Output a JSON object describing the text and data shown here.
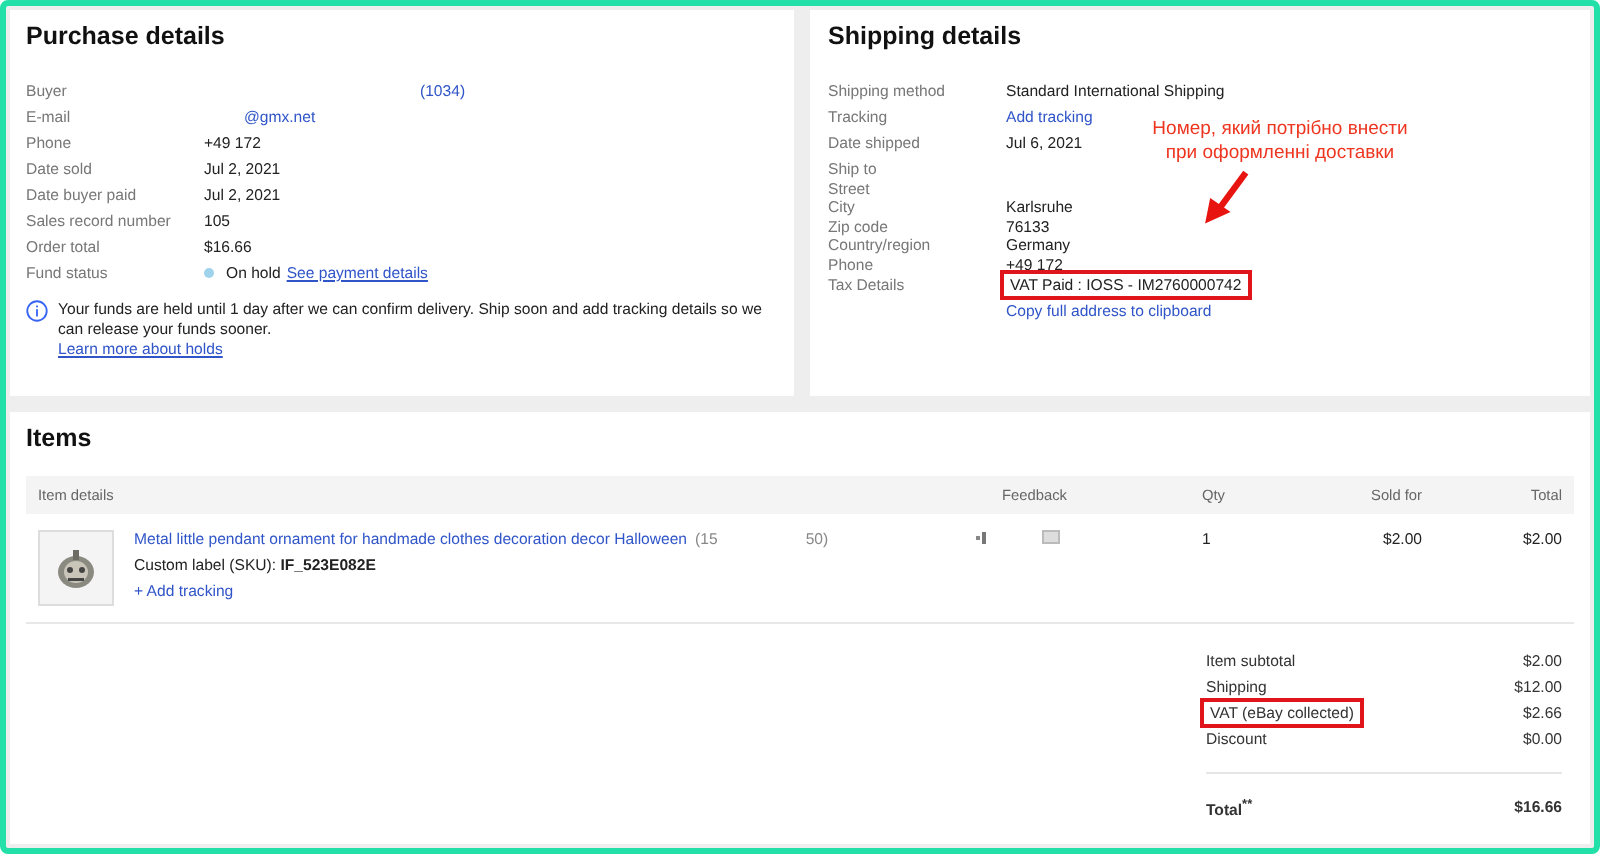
{
  "purchase": {
    "title": "Purchase details",
    "rows": [
      {
        "label": "Buyer",
        "value": "(1034)",
        "kind": "link"
      },
      {
        "label": "E-mail",
        "value": "@gmx.net",
        "kind": "link"
      },
      {
        "label": "Phone",
        "value": "+49 172",
        "kind": "text"
      },
      {
        "label": "Date sold",
        "value": "Jul 2, 2021",
        "kind": "text"
      },
      {
        "label": "Date buyer paid",
        "value": "Jul 2, 2021",
        "kind": "text"
      },
      {
        "label": "Sales record number",
        "value": "105",
        "kind": "text"
      },
      {
        "label": "Order total",
        "value": "$16.66",
        "kind": "text"
      },
      {
        "label": "Fund status",
        "value": "On hold",
        "kind": "status",
        "color": "#9fd3ec",
        "link": "See payment details"
      }
    ],
    "notice": {
      "text": "Your funds are held until 1 day after we can confirm delivery. Ship soon and add tracking details so we can release your funds sooner.",
      "link": "Learn more about holds"
    }
  },
  "shipping": {
    "title": "Shipping details",
    "rows": [
      {
        "label": "Shipping method",
        "value": "Standard International Shipping",
        "kind": "text"
      },
      {
        "label": "Tracking",
        "value": "Add tracking",
        "kind": "link"
      },
      {
        "label": "Date shipped",
        "value": "Jul 6, 2021",
        "kind": "text"
      }
    ],
    "address": [
      {
        "label": "Ship to"
      },
      {
        "label": "Street"
      },
      {
        "label": "City",
        "value": "Karlsruhe"
      },
      {
        "label": "Zip code",
        "value": "76133"
      },
      {
        "label": "Country/region",
        "value": "Germany"
      },
      {
        "label": "Phone",
        "value": "+49 172"
      }
    ],
    "tax": {
      "label": "Tax Details",
      "value": "VAT Paid : IOSS - IM2760000742",
      "highlighted": true
    },
    "copy_link": "Copy full address to clipboard",
    "annotation": "Номер, який потрібно внести при оформленні доставки"
  },
  "items": {
    "title": "Items",
    "columns": [
      "Item details",
      "Feedback",
      "Qty",
      "Sold for",
      "Total"
    ],
    "rows": [
      {
        "title": "Metal little pendant ornament for handmade clothes decoration decor Halloween",
        "id_start": "(15",
        "id_end": "50)",
        "sku_label": "Custom label (SKU):",
        "sku": "IF_523E082E",
        "add_tracking": "+ Add tracking",
        "qty": "1",
        "sold_for": "$2.00",
        "total": "$2.00"
      }
    ],
    "summary": [
      {
        "label": "Item subtotal",
        "value": "$2.00",
        "highlighted": false
      },
      {
        "label": "Shipping",
        "value": "$12.00",
        "highlighted": false
      },
      {
        "label": "VAT (eBay collected)",
        "value": "$2.66",
        "highlighted": true
      },
      {
        "label": "Discount",
        "value": "$0.00",
        "highlighted": false
      }
    ],
    "total": {
      "label": "Total$^{**}$",
      "value": "$16.66"
    }
  }
}
